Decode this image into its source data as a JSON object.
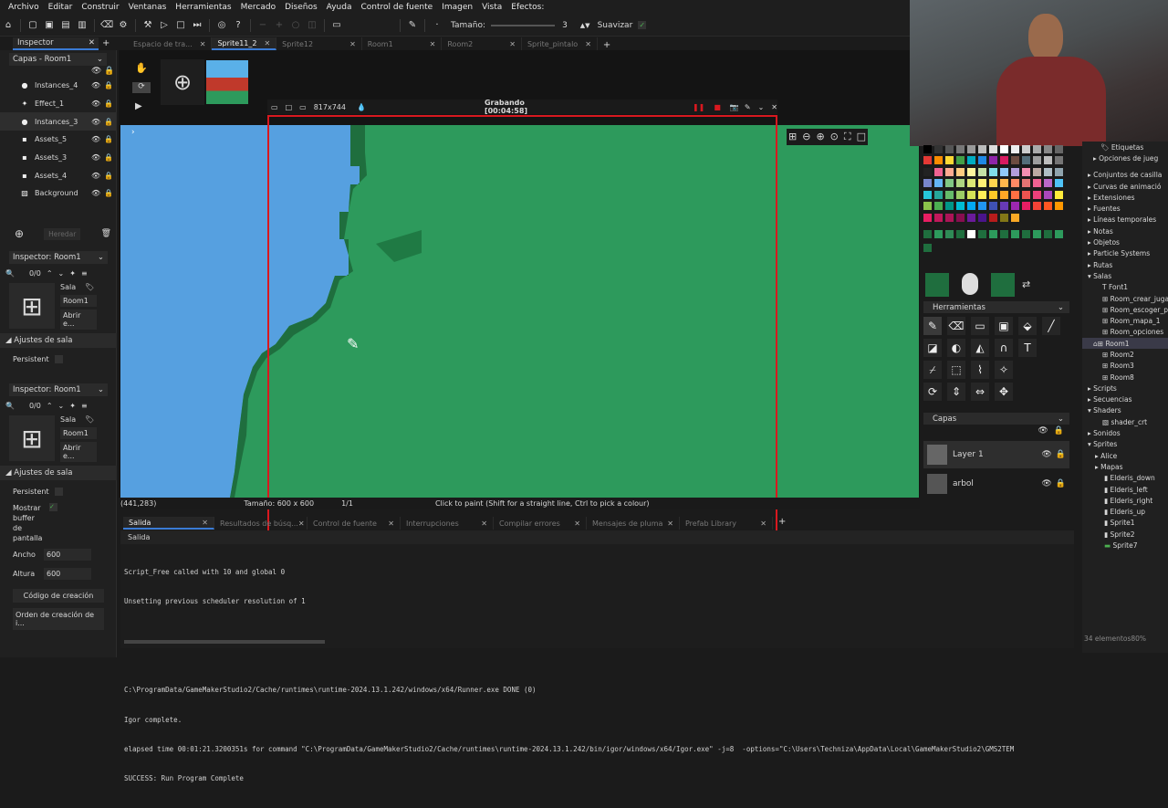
{
  "menu": [
    "Archivo",
    "Editar",
    "Construir",
    "Ventanas",
    "Herramientas",
    "Mercado",
    "Diseños",
    "Ayuda",
    "Control de fuente",
    "Imagen",
    "Vista",
    "Efectos:"
  ],
  "toolbar": {
    "size_label": "Tamaño:",
    "size_value": "3",
    "smooth_label": "Suavizar"
  },
  "left_tabs": {
    "inspector": "Inspector"
  },
  "tabs": [
    "Espacio de tra...",
    "Sprite11_2",
    "Sprite12",
    "Room1",
    "Room2",
    "Sprite_pintalo"
  ],
  "layers_select": "Capas - Room1",
  "layers": [
    "Instances_4",
    "Effect_1",
    "Instances_3",
    "Assets_5",
    "Assets_3",
    "Assets_4",
    "Background"
  ],
  "inherit": "Heredar",
  "inspector1": {
    "title": "Inspector: Room1",
    "count": "0/0",
    "sala": "Sala",
    "room": "Room1",
    "open": "Abrir e...",
    "settings": "Ajustes de sala",
    "persist": "Persistent"
  },
  "inspector2": {
    "title": "Inspector: Room1",
    "count": "0/0",
    "sala": "Sala",
    "room": "Room1",
    "open": "Abrir e...",
    "settings": "Ajustes de sala",
    "persist": "Persistent",
    "viewport": "Mostrar buffer de pantalla",
    "width_label": "Ancho",
    "width": "600",
    "height_label": "Altura",
    "height": "600",
    "creation_code": "Código de creación",
    "order": "Orden de creación de i..."
  },
  "recorder": {
    "size": "817x744",
    "title": "Grabando [00:04:58]"
  },
  "status": {
    "coords": "(441,283)",
    "size": "Tamaño: 600 x 600",
    "frame": "1/1",
    "hint": "Click to paint (Shift for a straight line, Ctrl to pick a colour)"
  },
  "output_tabs": [
    "Salida",
    "Resultados de búsq...",
    "Control de fuente",
    "Interrupciones",
    "Compilar errores",
    "Mensajes de pluma",
    "Prefab Library"
  ],
  "output_header": "Salida",
  "output_lines": [
    "Script_Free called with 10 and global 0",
    "Unsetting previous scheduler resolution of 1",
    "",
    "",
    "C:\\ProgramData/GameMakerStudio2/Cache/runtimes\\runtime-2024.13.1.242/windows/x64/Runner.exe DONE (0)",
    "Igor complete.",
    "elapsed time 00:01:21.3200351s for command \"C:\\ProgramData/GameMakerStudio2/Cache/runtimes\\runtime-2024.13.1.242/bin/igor/windows/x64/Igor.exe\" -j=8  -options=\"C:\\Users\\Techniza\\AppData\\Local\\GameMakerStudio2\\GMS2TEM",
    "SUCCESS: Run Program Complete"
  ],
  "tools_header": "Herramientas",
  "capas_header": "Capas",
  "sprite_layers": [
    "Layer 1",
    "arbol"
  ],
  "tree": [
    "Etiquetas",
    "Opciones de jueg",
    "Conjuntos de casilla",
    "Curvas de animació",
    "Extensiones",
    "Fuentes",
    "Líneas temporales",
    "Notas",
    "Objetos",
    "Particle Systems",
    "Rutas",
    "Salas",
    "Font1",
    "Room_crear_jugad",
    "Room_escoger_pe",
    "Room_mapa_1",
    "Room_opciones",
    "Room1",
    "Room2",
    "Room3",
    "Room8",
    "Scripts",
    "Secuencias",
    "Shaders",
    "shader_crt",
    "Sonidos",
    "Sprites",
    "Alice",
    "Mapas",
    "Elderis_down",
    "Elderis_left",
    "Elderis_right",
    "Elderis_up",
    "Sprite1",
    "Sprite2",
    "Sprite7"
  ],
  "footer": "34 elementos",
  "zoom": "80%",
  "colors": {
    "accent": "#3a7bd5",
    "rec": "#d8181f",
    "green": "#2d9a5c",
    "water": "#56a0e0"
  }
}
